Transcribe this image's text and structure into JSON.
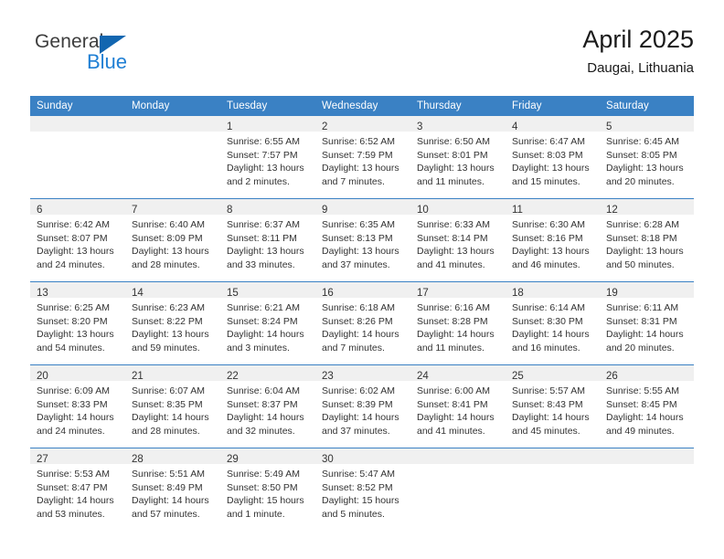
{
  "brand": {
    "name_part1": "General",
    "name_part2": "Blue",
    "triangle_icon": "blue-triangle-icon",
    "accent_color": "#1f7fd4"
  },
  "header": {
    "title": "April 2025",
    "subtitle": "Daugai, Lithuania"
  },
  "calendar": {
    "header_bg": "#3a81c4",
    "daynum_band_bg": "#f0f0f0",
    "weekdays": [
      "Sunday",
      "Monday",
      "Tuesday",
      "Wednesday",
      "Thursday",
      "Friday",
      "Saturday"
    ],
    "weeks": [
      [
        {
          "day": "",
          "lines": []
        },
        {
          "day": "",
          "lines": []
        },
        {
          "day": "1",
          "lines": [
            "Sunrise: 6:55 AM",
            "Sunset: 7:57 PM",
            "Daylight: 13 hours",
            "and 2 minutes."
          ]
        },
        {
          "day": "2",
          "lines": [
            "Sunrise: 6:52 AM",
            "Sunset: 7:59 PM",
            "Daylight: 13 hours",
            "and 7 minutes."
          ]
        },
        {
          "day": "3",
          "lines": [
            "Sunrise: 6:50 AM",
            "Sunset: 8:01 PM",
            "Daylight: 13 hours",
            "and 11 minutes."
          ]
        },
        {
          "day": "4",
          "lines": [
            "Sunrise: 6:47 AM",
            "Sunset: 8:03 PM",
            "Daylight: 13 hours",
            "and 15 minutes."
          ]
        },
        {
          "day": "5",
          "lines": [
            "Sunrise: 6:45 AM",
            "Sunset: 8:05 PM",
            "Daylight: 13 hours",
            "and 20 minutes."
          ]
        }
      ],
      [
        {
          "day": "6",
          "lines": [
            "Sunrise: 6:42 AM",
            "Sunset: 8:07 PM",
            "Daylight: 13 hours",
            "and 24 minutes."
          ]
        },
        {
          "day": "7",
          "lines": [
            "Sunrise: 6:40 AM",
            "Sunset: 8:09 PM",
            "Daylight: 13 hours",
            "and 28 minutes."
          ]
        },
        {
          "day": "8",
          "lines": [
            "Sunrise: 6:37 AM",
            "Sunset: 8:11 PM",
            "Daylight: 13 hours",
            "and 33 minutes."
          ]
        },
        {
          "day": "9",
          "lines": [
            "Sunrise: 6:35 AM",
            "Sunset: 8:13 PM",
            "Daylight: 13 hours",
            "and 37 minutes."
          ]
        },
        {
          "day": "10",
          "lines": [
            "Sunrise: 6:33 AM",
            "Sunset: 8:14 PM",
            "Daylight: 13 hours",
            "and 41 minutes."
          ]
        },
        {
          "day": "11",
          "lines": [
            "Sunrise: 6:30 AM",
            "Sunset: 8:16 PM",
            "Daylight: 13 hours",
            "and 46 minutes."
          ]
        },
        {
          "day": "12",
          "lines": [
            "Sunrise: 6:28 AM",
            "Sunset: 8:18 PM",
            "Daylight: 13 hours",
            "and 50 minutes."
          ]
        }
      ],
      [
        {
          "day": "13",
          "lines": [
            "Sunrise: 6:25 AM",
            "Sunset: 8:20 PM",
            "Daylight: 13 hours",
            "and 54 minutes."
          ]
        },
        {
          "day": "14",
          "lines": [
            "Sunrise: 6:23 AM",
            "Sunset: 8:22 PM",
            "Daylight: 13 hours",
            "and 59 minutes."
          ]
        },
        {
          "day": "15",
          "lines": [
            "Sunrise: 6:21 AM",
            "Sunset: 8:24 PM",
            "Daylight: 14 hours",
            "and 3 minutes."
          ]
        },
        {
          "day": "16",
          "lines": [
            "Sunrise: 6:18 AM",
            "Sunset: 8:26 PM",
            "Daylight: 14 hours",
            "and 7 minutes."
          ]
        },
        {
          "day": "17",
          "lines": [
            "Sunrise: 6:16 AM",
            "Sunset: 8:28 PM",
            "Daylight: 14 hours",
            "and 11 minutes."
          ]
        },
        {
          "day": "18",
          "lines": [
            "Sunrise: 6:14 AM",
            "Sunset: 8:30 PM",
            "Daylight: 14 hours",
            "and 16 minutes."
          ]
        },
        {
          "day": "19",
          "lines": [
            "Sunrise: 6:11 AM",
            "Sunset: 8:31 PM",
            "Daylight: 14 hours",
            "and 20 minutes."
          ]
        }
      ],
      [
        {
          "day": "20",
          "lines": [
            "Sunrise: 6:09 AM",
            "Sunset: 8:33 PM",
            "Daylight: 14 hours",
            "and 24 minutes."
          ]
        },
        {
          "day": "21",
          "lines": [
            "Sunrise: 6:07 AM",
            "Sunset: 8:35 PM",
            "Daylight: 14 hours",
            "and 28 minutes."
          ]
        },
        {
          "day": "22",
          "lines": [
            "Sunrise: 6:04 AM",
            "Sunset: 8:37 PM",
            "Daylight: 14 hours",
            "and 32 minutes."
          ]
        },
        {
          "day": "23",
          "lines": [
            "Sunrise: 6:02 AM",
            "Sunset: 8:39 PM",
            "Daylight: 14 hours",
            "and 37 minutes."
          ]
        },
        {
          "day": "24",
          "lines": [
            "Sunrise: 6:00 AM",
            "Sunset: 8:41 PM",
            "Daylight: 14 hours",
            "and 41 minutes."
          ]
        },
        {
          "day": "25",
          "lines": [
            "Sunrise: 5:57 AM",
            "Sunset: 8:43 PM",
            "Daylight: 14 hours",
            "and 45 minutes."
          ]
        },
        {
          "day": "26",
          "lines": [
            "Sunrise: 5:55 AM",
            "Sunset: 8:45 PM",
            "Daylight: 14 hours",
            "and 49 minutes."
          ]
        }
      ],
      [
        {
          "day": "27",
          "lines": [
            "Sunrise: 5:53 AM",
            "Sunset: 8:47 PM",
            "Daylight: 14 hours",
            "and 53 minutes."
          ]
        },
        {
          "day": "28",
          "lines": [
            "Sunrise: 5:51 AM",
            "Sunset: 8:49 PM",
            "Daylight: 14 hours",
            "and 57 minutes."
          ]
        },
        {
          "day": "29",
          "lines": [
            "Sunrise: 5:49 AM",
            "Sunset: 8:50 PM",
            "Daylight: 15 hours",
            "and 1 minute."
          ]
        },
        {
          "day": "30",
          "lines": [
            "Sunrise: 5:47 AM",
            "Sunset: 8:52 PM",
            "Daylight: 15 hours",
            "and 5 minutes."
          ]
        },
        {
          "day": "",
          "lines": []
        },
        {
          "day": "",
          "lines": []
        },
        {
          "day": "",
          "lines": []
        }
      ]
    ]
  }
}
